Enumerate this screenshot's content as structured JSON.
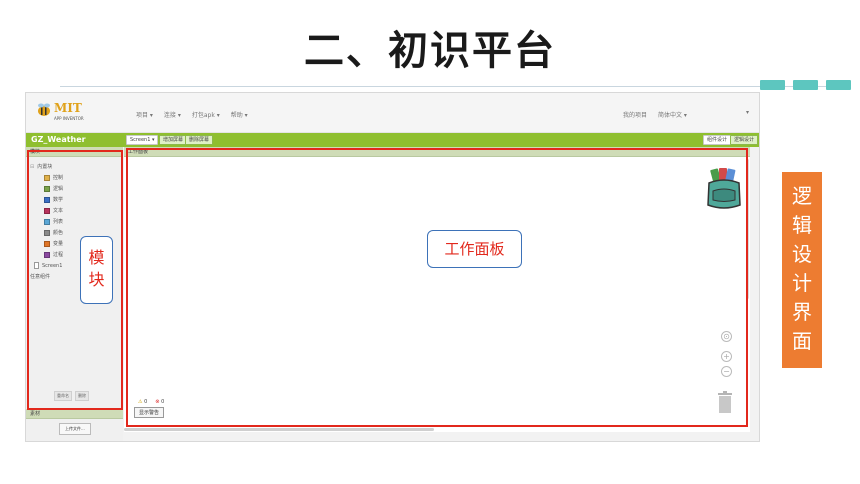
{
  "slide": {
    "title": "二、初识平台",
    "side_label": [
      "逻",
      "辑",
      "设",
      "计",
      "界",
      "面"
    ],
    "bubble_left": [
      "模",
      "块"
    ],
    "bubble_main": "工作面板"
  },
  "app": {
    "logo_text": "MIT",
    "logo_sub": "APP INVENTOR",
    "menu": [
      "项目 ▾",
      "连接 ▾",
      "打包apk ▾",
      "帮助 ▾"
    ],
    "right_menu": [
      "我的项目",
      "简体中文 ▾"
    ],
    "project_name": "GZ_Weather",
    "screen_buttons": [
      "Screen1 ▾",
      "增加屏幕",
      "删除屏幕"
    ],
    "view_buttons": [
      "组件设计",
      "逻辑设计"
    ]
  },
  "sidebar": {
    "header": "模块",
    "root": "内置块",
    "blocks": [
      {
        "label": "控制",
        "color": "#e0b14a"
      },
      {
        "label": "逻辑",
        "color": "#7ba34a"
      },
      {
        "label": "数学",
        "color": "#3b6fc4"
      },
      {
        "label": "文本",
        "color": "#b8325b"
      },
      {
        "label": "列表",
        "color": "#5ba7d6"
      },
      {
        "label": "颜色",
        "color": "#8a8a8a"
      },
      {
        "label": "变量",
        "color": "#e07628"
      },
      {
        "label": "过程",
        "color": "#8b4aa0"
      }
    ],
    "screen_item": "Screen1",
    "any_component": "任意组件",
    "buttons": [
      "重命名",
      "删除"
    ],
    "media_header": "素材",
    "upload_button": "上传文件..."
  },
  "workspace": {
    "header": "工作面板",
    "warnings": "0",
    "errors": "0",
    "show_warnings_button": "显示警告"
  },
  "colors": {
    "accent_green": "#8fbf2f",
    "highlight_red": "#e2281c",
    "side_orange": "#ed7c31"
  }
}
